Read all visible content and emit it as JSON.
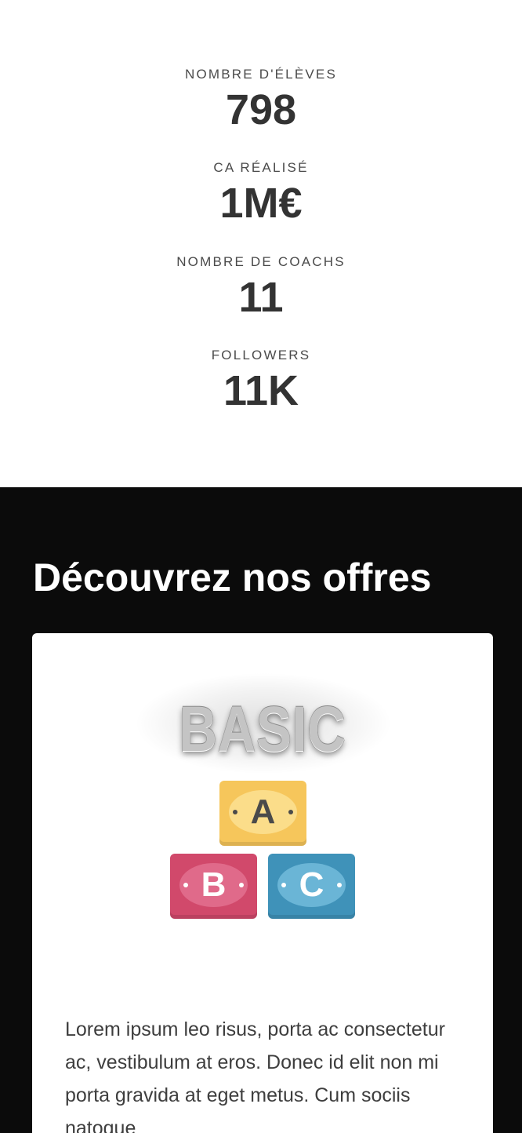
{
  "stats": [
    {
      "label": "NOMBRE D'ÉLÈVES",
      "value": "798"
    },
    {
      "label": "CA RÉALISÉ",
      "value": "1M€"
    },
    {
      "label": "NOMBRE DE COACHS",
      "value": "11"
    },
    {
      "label": "FOLLOWERS",
      "value": "11K"
    }
  ],
  "offers": {
    "title": "Découvrez nos offres",
    "card": {
      "logo": {
        "word": "BASIC",
        "blocks": [
          {
            "letter": "A",
            "color": "#f6c65b"
          },
          {
            "letter": "B",
            "color": "#d1496b"
          },
          {
            "letter": "C",
            "color": "#3f92b9"
          }
        ]
      },
      "description": "Lorem ipsum leo risus, porta ac consectetur ac, vestibulum at eros. Donec id elit non mi porta gravida at eget metus. Cum sociis natoque"
    }
  },
  "colors": {
    "stat_label": "#4a4a4a",
    "stat_value": "#333333",
    "offers_background": "#0b0b0b",
    "offers_title": "#ffffff",
    "card_background": "#ffffff",
    "description_text": "#3e3e3e"
  }
}
